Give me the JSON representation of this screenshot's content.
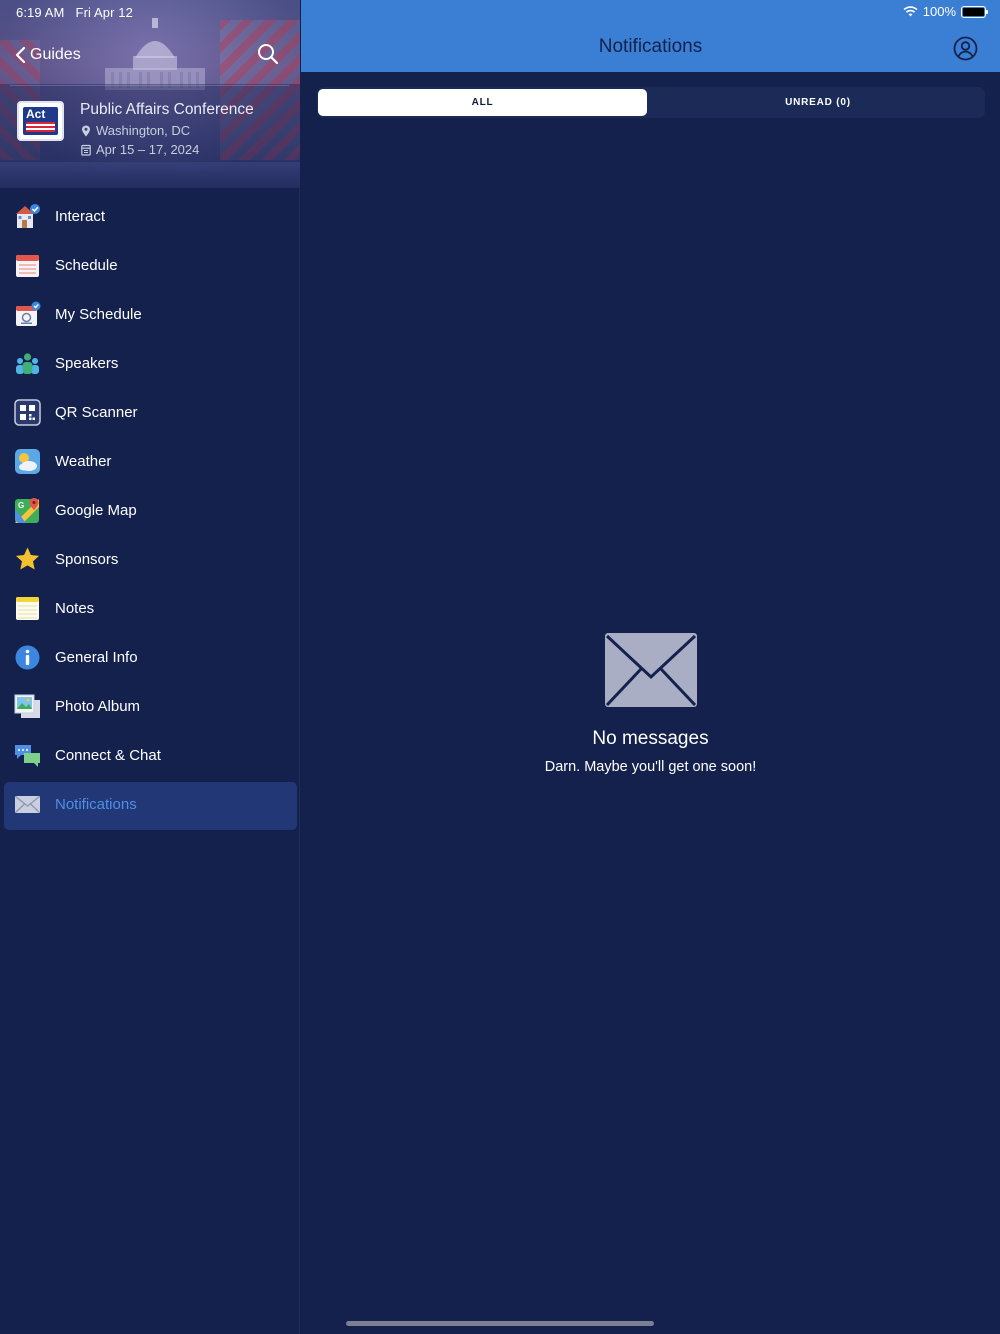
{
  "status_bar": {
    "time": "6:19 AM",
    "date": "Fri Apr 12",
    "battery": "100%"
  },
  "sidebar": {
    "back_label": "Guides",
    "event": {
      "logo_text": "Act",
      "title": "Public Affairs Conference",
      "location": "Washington, DC",
      "dates": "Apr 15 – 17, 2024"
    },
    "items": [
      {
        "label": "Interact",
        "icon": "interact-icon"
      },
      {
        "label": "Schedule",
        "icon": "calendar-icon"
      },
      {
        "label": "My Schedule",
        "icon": "my-schedule-icon"
      },
      {
        "label": "Speakers",
        "icon": "people-icon"
      },
      {
        "label": "QR Scanner",
        "icon": "qr-code-icon"
      },
      {
        "label": "Weather",
        "icon": "weather-icon"
      },
      {
        "label": "Google Map",
        "icon": "map-icon"
      },
      {
        "label": "Sponsors",
        "icon": "star-icon"
      },
      {
        "label": "Notes",
        "icon": "notes-icon"
      },
      {
        "label": "General Info",
        "icon": "info-icon"
      },
      {
        "label": "Photo Album",
        "icon": "photo-icon"
      },
      {
        "label": "Connect & Chat",
        "icon": "chat-icon"
      },
      {
        "label": "Notifications",
        "icon": "envelope-icon",
        "active": true
      }
    ]
  },
  "header": {
    "title": "Notifications"
  },
  "tabs": {
    "all": "ALL",
    "unread": "UNREAD (0)",
    "selected": "ALL"
  },
  "empty_state": {
    "title": "No messages",
    "subtitle": "Darn. Maybe you'll get one soon!"
  },
  "colors": {
    "background": "#14214d",
    "header": "#3a7fd4",
    "active_item": "#223775",
    "accent_text": "#4f8fe6"
  }
}
